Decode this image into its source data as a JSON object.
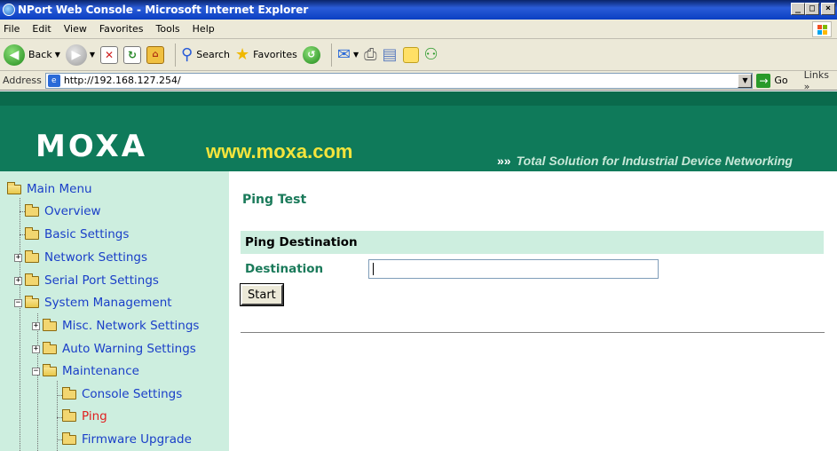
{
  "window": {
    "title": "NPort Web Console - Microsoft Internet Explorer"
  },
  "menubar": {
    "items": [
      "File",
      "Edit",
      "View",
      "Favorites",
      "Tools",
      "Help"
    ]
  },
  "toolbar": {
    "back_label": "Back",
    "search_label": "Search",
    "favorites_label": "Favorites"
  },
  "addressbar": {
    "label": "Address",
    "url": "http://192.168.127.254/",
    "go_label": "Go",
    "links_label": "Links »"
  },
  "banner": {
    "logo": "MOXA",
    "site": "www.moxa.com",
    "tagline": "Total Solution for Industrial Device Networking",
    "tagline_arrows": "»»"
  },
  "sidebar": {
    "items": [
      {
        "label": "Main Menu"
      },
      {
        "label": "Overview"
      },
      {
        "label": "Basic Settings"
      },
      {
        "label": "Network Settings"
      },
      {
        "label": "Serial Port Settings"
      },
      {
        "label": "System Management"
      },
      {
        "label": "Misc. Network Settings"
      },
      {
        "label": "Auto Warning Settings"
      },
      {
        "label": "Maintenance"
      },
      {
        "label": "Console Settings"
      },
      {
        "label": "Ping"
      },
      {
        "label": "Firmware Upgrade"
      }
    ]
  },
  "main": {
    "page_title": "Ping Test",
    "section_header": "Ping Destination",
    "destination_label": "Destination",
    "destination_value": "",
    "start_label": "Start"
  },
  "colors": {
    "banner": "#0f7a5a",
    "sidebar_bg": "#cdeedf",
    "accent_green": "#1a7a5a",
    "link_blue": "#1a3fc8",
    "active_red": "#e02020"
  }
}
